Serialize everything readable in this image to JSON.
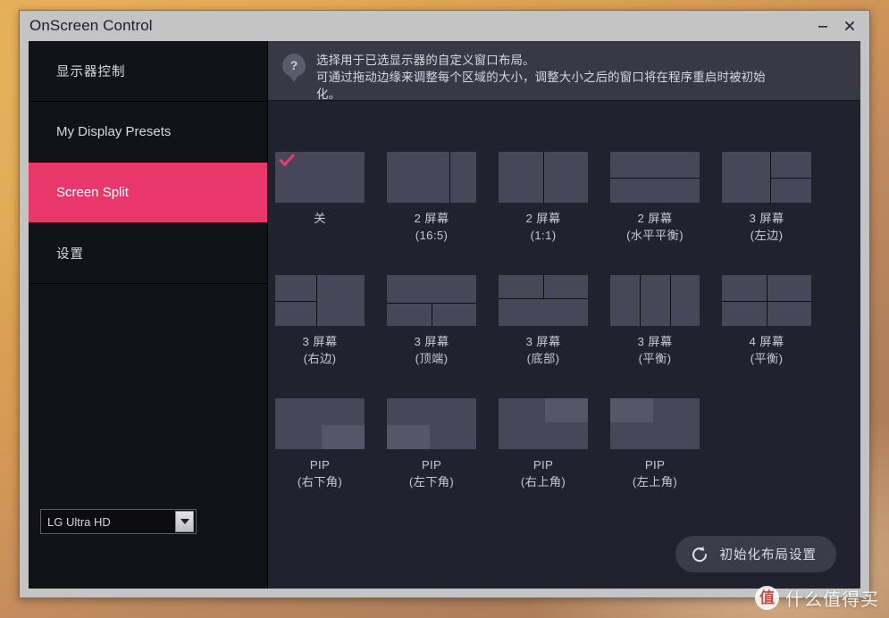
{
  "window": {
    "title": "OnScreen Control",
    "minimize_label": "minimize",
    "close_label": "close"
  },
  "sidebar": {
    "items": [
      {
        "label": "显示器控制",
        "active": false,
        "cjk": true
      },
      {
        "label": "My Display Presets",
        "active": false,
        "cjk": false
      },
      {
        "label": "Screen Split",
        "active": true,
        "cjk": false
      },
      {
        "label": "设置",
        "active": false,
        "cjk": true
      }
    ],
    "monitor_select": {
      "value": "LG Ultra HD",
      "placeholder": "LG Ultra HD"
    }
  },
  "help": {
    "icon": "question-mark-pin-icon",
    "line1": "选择用于已选显示器的自定义窗口布局。",
    "line2": "可通过拖动边缘来调整每个区域的大小，调整大小之后的窗口将在程序重启时被初始",
    "line3": "化。"
  },
  "layouts": [
    {
      "label": "关",
      "selected": true,
      "kind": "off"
    },
    {
      "label": "2 屏幕\n(16:5)",
      "selected": false,
      "kind": "v1-70"
    },
    {
      "label": "2 屏幕\n(1:1)",
      "selected": false,
      "kind": "v1-50"
    },
    {
      "label": "2 屏幕\n(水平平衡)",
      "selected": false,
      "kind": "h1-50"
    },
    {
      "label": "3 屏幕\n(左边)",
      "selected": false,
      "kind": "left-big"
    },
    {
      "label": "3 屏幕\n(右边)",
      "selected": false,
      "kind": "right-big"
    },
    {
      "label": "3 屏幕\n(顶端)",
      "selected": false,
      "kind": "top-big"
    },
    {
      "label": "3 屏幕\n(底部)",
      "selected": false,
      "kind": "bottom-big"
    },
    {
      "label": "3 屏幕\n(平衡)",
      "selected": false,
      "kind": "cols3"
    },
    {
      "label": "4 屏幕\n(平衡)",
      "selected": false,
      "kind": "grid4"
    },
    {
      "label": "PIP\n(右下角)",
      "selected": false,
      "kind": "pip-br"
    },
    {
      "label": "PIP\n(左下角)",
      "selected": false,
      "kind": "pip-bl"
    },
    {
      "label": "PIP\n(右上角)",
      "selected": false,
      "kind": "pip-tr"
    },
    {
      "label": "PIP\n(左上角)",
      "selected": false,
      "kind": "pip-tl"
    }
  ],
  "reset_button": {
    "label": "初始化布局设置",
    "icon": "refresh-icon"
  },
  "watermark": {
    "logo": "值",
    "text": "什么值得买"
  },
  "colors": {
    "accent_pink": "#e8386b",
    "sidebar_bg": "#121219",
    "panel_bg": "#22222e",
    "tile_bg": "#474759",
    "pip_bg": "#565668",
    "titlebar_bg": "#c4c4c4",
    "help_bg": "#393946",
    "checkmark": "#ef3a6e"
  }
}
